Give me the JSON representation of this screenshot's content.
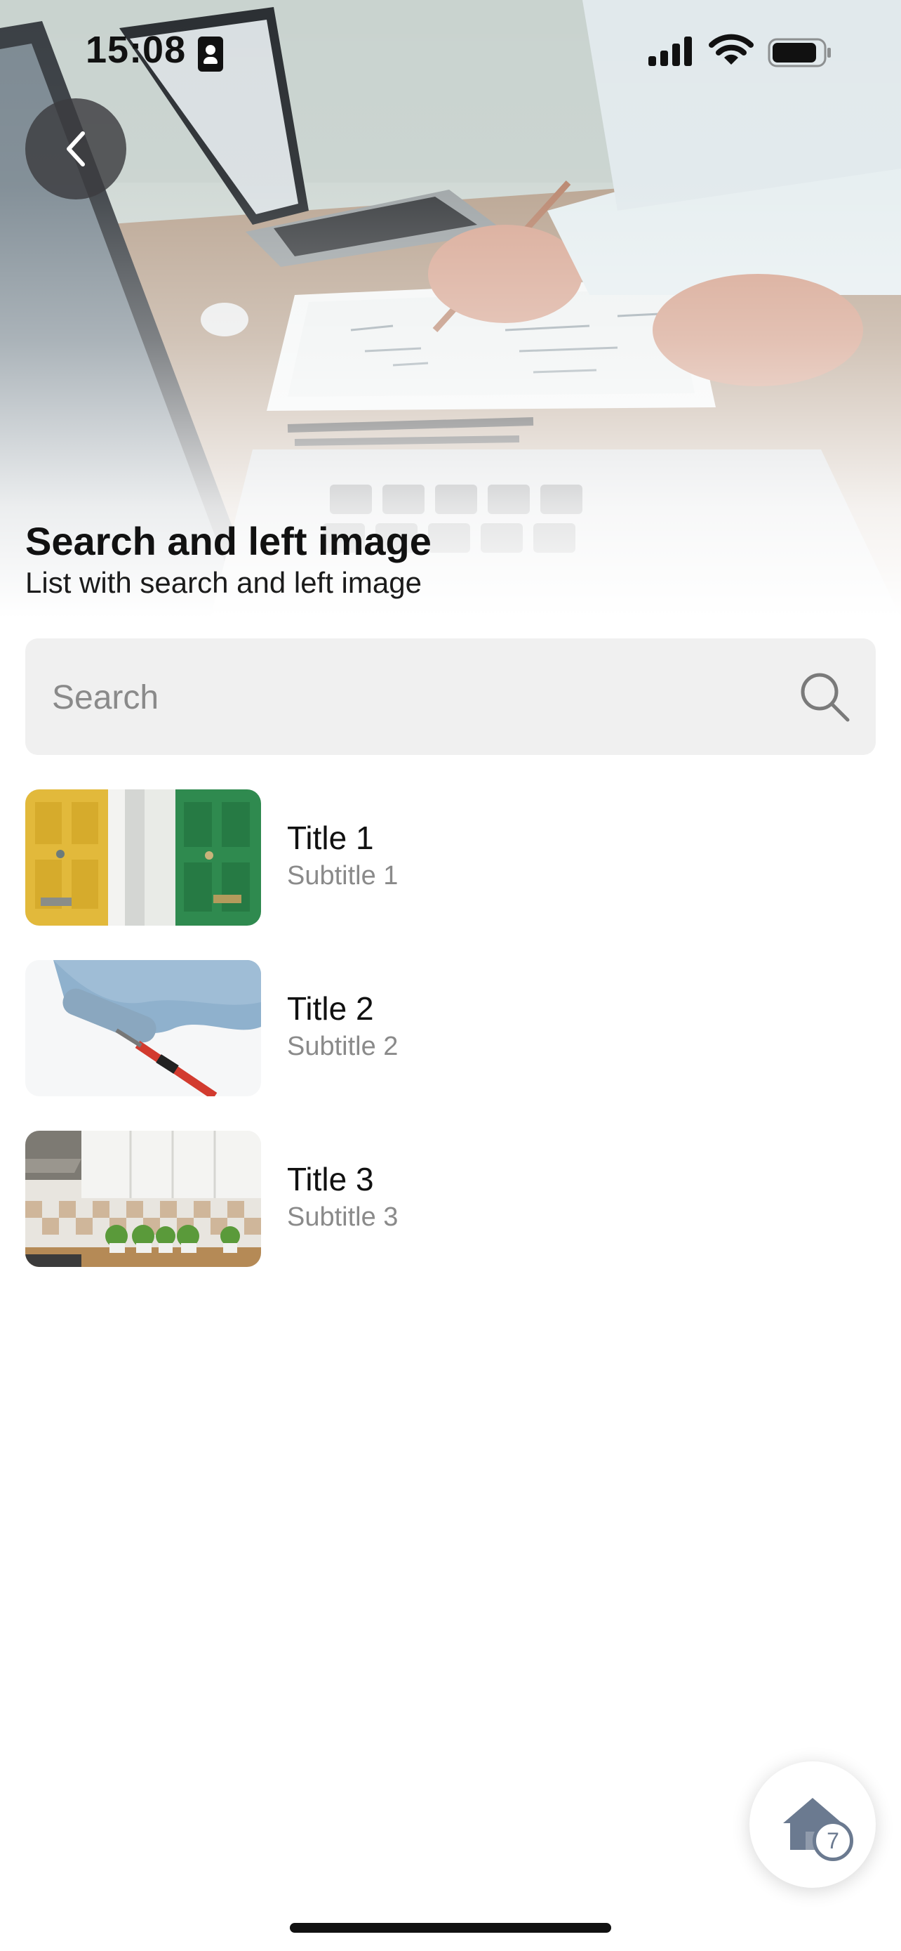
{
  "status_bar": {
    "time": "15:08"
  },
  "header": {
    "title": "Search and left image",
    "subtitle": "List with search and left image"
  },
  "search": {
    "placeholder": "Search",
    "value": ""
  },
  "list": {
    "items": [
      {
        "title": "Title 1",
        "subtitle": "Subtitle 1"
      },
      {
        "title": "Title 2",
        "subtitle": "Subtitle 2"
      },
      {
        "title": "Title 3",
        "subtitle": "Subtitle 3"
      }
    ]
  },
  "fab": {
    "icon": "home-icon",
    "badge": "7"
  },
  "icons": {
    "back": "chevron-left-icon",
    "search": "search-icon",
    "signal": "cellular-signal-icon",
    "wifi": "wifi-icon",
    "battery": "battery-icon"
  },
  "colors": {
    "search_bg": "#f0f0f0",
    "subtitle_gray": "#8a8a8a",
    "fab_icon": "#6b7a90",
    "back_button_bg": "#3c3c40"
  }
}
